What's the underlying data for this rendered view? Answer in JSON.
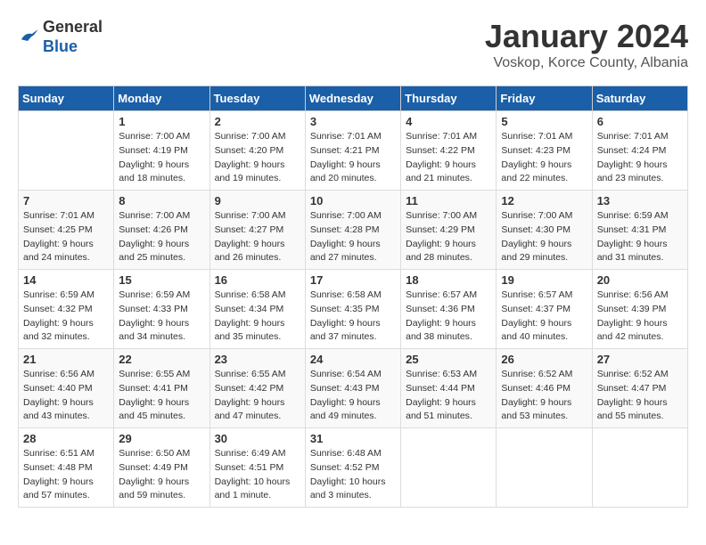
{
  "header": {
    "logo_general": "General",
    "logo_blue": "Blue",
    "month": "January 2024",
    "location": "Voskop, Korce County, Albania"
  },
  "calendar": {
    "days_of_week": [
      "Sunday",
      "Monday",
      "Tuesday",
      "Wednesday",
      "Thursday",
      "Friday",
      "Saturday"
    ],
    "weeks": [
      [
        {
          "day": "",
          "sunrise": "",
          "sunset": "",
          "daylight": ""
        },
        {
          "day": "1",
          "sunrise": "Sunrise: 7:00 AM",
          "sunset": "Sunset: 4:19 PM",
          "daylight": "Daylight: 9 hours and 18 minutes."
        },
        {
          "day": "2",
          "sunrise": "Sunrise: 7:00 AM",
          "sunset": "Sunset: 4:20 PM",
          "daylight": "Daylight: 9 hours and 19 minutes."
        },
        {
          "day": "3",
          "sunrise": "Sunrise: 7:01 AM",
          "sunset": "Sunset: 4:21 PM",
          "daylight": "Daylight: 9 hours and 20 minutes."
        },
        {
          "day": "4",
          "sunrise": "Sunrise: 7:01 AM",
          "sunset": "Sunset: 4:22 PM",
          "daylight": "Daylight: 9 hours and 21 minutes."
        },
        {
          "day": "5",
          "sunrise": "Sunrise: 7:01 AM",
          "sunset": "Sunset: 4:23 PM",
          "daylight": "Daylight: 9 hours and 22 minutes."
        },
        {
          "day": "6",
          "sunrise": "Sunrise: 7:01 AM",
          "sunset": "Sunset: 4:24 PM",
          "daylight": "Daylight: 9 hours and 23 minutes."
        }
      ],
      [
        {
          "day": "7",
          "sunrise": "Sunrise: 7:01 AM",
          "sunset": "Sunset: 4:25 PM",
          "daylight": "Daylight: 9 hours and 24 minutes."
        },
        {
          "day": "8",
          "sunrise": "Sunrise: 7:00 AM",
          "sunset": "Sunset: 4:26 PM",
          "daylight": "Daylight: 9 hours and 25 minutes."
        },
        {
          "day": "9",
          "sunrise": "Sunrise: 7:00 AM",
          "sunset": "Sunset: 4:27 PM",
          "daylight": "Daylight: 9 hours and 26 minutes."
        },
        {
          "day": "10",
          "sunrise": "Sunrise: 7:00 AM",
          "sunset": "Sunset: 4:28 PM",
          "daylight": "Daylight: 9 hours and 27 minutes."
        },
        {
          "day": "11",
          "sunrise": "Sunrise: 7:00 AM",
          "sunset": "Sunset: 4:29 PM",
          "daylight": "Daylight: 9 hours and 28 minutes."
        },
        {
          "day": "12",
          "sunrise": "Sunrise: 7:00 AM",
          "sunset": "Sunset: 4:30 PM",
          "daylight": "Daylight: 9 hours and 29 minutes."
        },
        {
          "day": "13",
          "sunrise": "Sunrise: 6:59 AM",
          "sunset": "Sunset: 4:31 PM",
          "daylight": "Daylight: 9 hours and 31 minutes."
        }
      ],
      [
        {
          "day": "14",
          "sunrise": "Sunrise: 6:59 AM",
          "sunset": "Sunset: 4:32 PM",
          "daylight": "Daylight: 9 hours and 32 minutes."
        },
        {
          "day": "15",
          "sunrise": "Sunrise: 6:59 AM",
          "sunset": "Sunset: 4:33 PM",
          "daylight": "Daylight: 9 hours and 34 minutes."
        },
        {
          "day": "16",
          "sunrise": "Sunrise: 6:58 AM",
          "sunset": "Sunset: 4:34 PM",
          "daylight": "Daylight: 9 hours and 35 minutes."
        },
        {
          "day": "17",
          "sunrise": "Sunrise: 6:58 AM",
          "sunset": "Sunset: 4:35 PM",
          "daylight": "Daylight: 9 hours and 37 minutes."
        },
        {
          "day": "18",
          "sunrise": "Sunrise: 6:57 AM",
          "sunset": "Sunset: 4:36 PM",
          "daylight": "Daylight: 9 hours and 38 minutes."
        },
        {
          "day": "19",
          "sunrise": "Sunrise: 6:57 AM",
          "sunset": "Sunset: 4:37 PM",
          "daylight": "Daylight: 9 hours and 40 minutes."
        },
        {
          "day": "20",
          "sunrise": "Sunrise: 6:56 AM",
          "sunset": "Sunset: 4:39 PM",
          "daylight": "Daylight: 9 hours and 42 minutes."
        }
      ],
      [
        {
          "day": "21",
          "sunrise": "Sunrise: 6:56 AM",
          "sunset": "Sunset: 4:40 PM",
          "daylight": "Daylight: 9 hours and 43 minutes."
        },
        {
          "day": "22",
          "sunrise": "Sunrise: 6:55 AM",
          "sunset": "Sunset: 4:41 PM",
          "daylight": "Daylight: 9 hours and 45 minutes."
        },
        {
          "day": "23",
          "sunrise": "Sunrise: 6:55 AM",
          "sunset": "Sunset: 4:42 PM",
          "daylight": "Daylight: 9 hours and 47 minutes."
        },
        {
          "day": "24",
          "sunrise": "Sunrise: 6:54 AM",
          "sunset": "Sunset: 4:43 PM",
          "daylight": "Daylight: 9 hours and 49 minutes."
        },
        {
          "day": "25",
          "sunrise": "Sunrise: 6:53 AM",
          "sunset": "Sunset: 4:44 PM",
          "daylight": "Daylight: 9 hours and 51 minutes."
        },
        {
          "day": "26",
          "sunrise": "Sunrise: 6:52 AM",
          "sunset": "Sunset: 4:46 PM",
          "daylight": "Daylight: 9 hours and 53 minutes."
        },
        {
          "day": "27",
          "sunrise": "Sunrise: 6:52 AM",
          "sunset": "Sunset: 4:47 PM",
          "daylight": "Daylight: 9 hours and 55 minutes."
        }
      ],
      [
        {
          "day": "28",
          "sunrise": "Sunrise: 6:51 AM",
          "sunset": "Sunset: 4:48 PM",
          "daylight": "Daylight: 9 hours and 57 minutes."
        },
        {
          "day": "29",
          "sunrise": "Sunrise: 6:50 AM",
          "sunset": "Sunset: 4:49 PM",
          "daylight": "Daylight: 9 hours and 59 minutes."
        },
        {
          "day": "30",
          "sunrise": "Sunrise: 6:49 AM",
          "sunset": "Sunset: 4:51 PM",
          "daylight": "Daylight: 10 hours and 1 minute."
        },
        {
          "day": "31",
          "sunrise": "Sunrise: 6:48 AM",
          "sunset": "Sunset: 4:52 PM",
          "daylight": "Daylight: 10 hours and 3 minutes."
        },
        {
          "day": "",
          "sunrise": "",
          "sunset": "",
          "daylight": ""
        },
        {
          "day": "",
          "sunrise": "",
          "sunset": "",
          "daylight": ""
        },
        {
          "day": "",
          "sunrise": "",
          "sunset": "",
          "daylight": ""
        }
      ]
    ]
  }
}
